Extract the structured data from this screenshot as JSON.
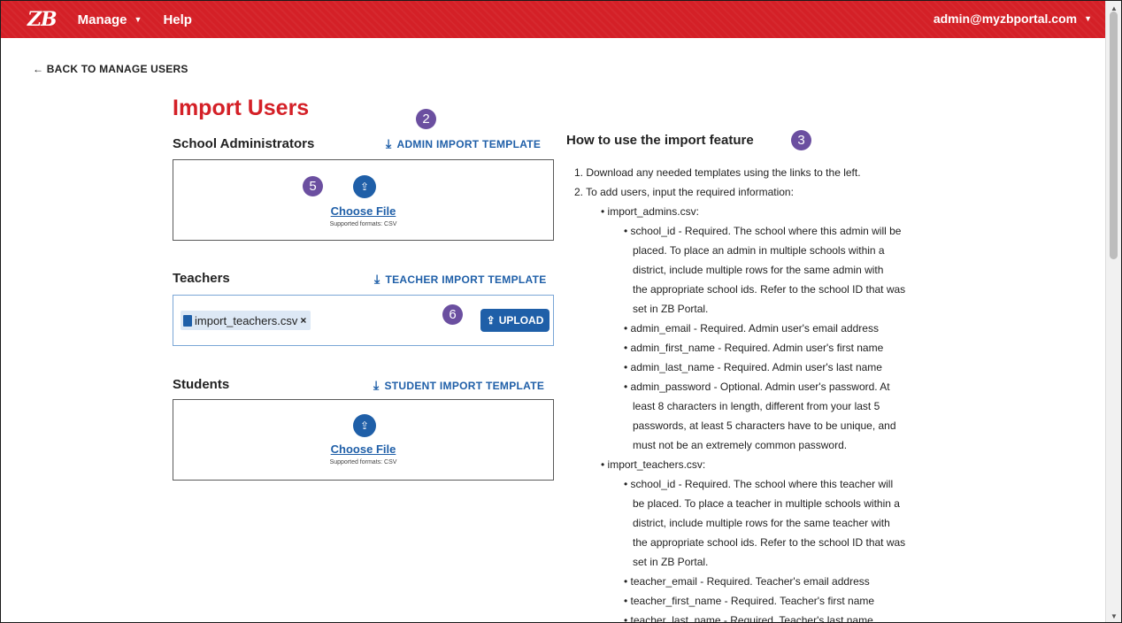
{
  "nav": {
    "logo": "ZB",
    "manage": "Manage",
    "help": "Help",
    "user": "admin@myzbportal.com"
  },
  "back_link": "← BACK TO MANAGE USERS",
  "page_title": "Import Users",
  "admins": {
    "label": "School Administrators",
    "template_link": "ADMIN IMPORT TEMPLATE",
    "choose": "Choose File",
    "formats": "Supported formats: CSV"
  },
  "teachers": {
    "label": "Teachers",
    "template_link": "TEACHER IMPORT TEMPLATE",
    "file": "import_teachers.csv",
    "remove": "×",
    "upload": "UPLOAD"
  },
  "students": {
    "label": "Students",
    "template_link": "STUDENT IMPORT TEMPLATE",
    "choose": "Choose File",
    "formats": "Supported formats: CSV"
  },
  "badges": {
    "b2": "2",
    "b3": "3",
    "b5": "5",
    "b6": "6"
  },
  "howto": {
    "title": "How to use the import feature",
    "lines": [
      "1. Download any needed templates using the links to the left.",
      "2. To add users, input the required information:",
      "• import_admins.csv:",
      "• school_id - Required. The school where this admin will be",
      "placed. To place an admin in multiple schools within a",
      "district, include multiple rows for the same admin with",
      "the appropriate school ids. Refer to the school ID that was",
      "set in ZB Portal.",
      "• admin_email - Required. Admin user's email address",
      "• admin_first_name - Required. Admin user's first name",
      "• admin_last_name - Required. Admin user's last name",
      "• admin_password - Optional. Admin user's password. At",
      "least 8 characters in length, different from your last 5",
      "passwords, at least 5 characters have to be unique, and",
      "must not be an extremely common password.",
      "• import_teachers.csv:",
      "• school_id - Required. The school where this teacher will",
      "be placed. To place a teacher in multiple schools within a",
      "district, include multiple rows for the same teacher with",
      "the appropriate school ids. Refer to the school ID that was",
      "set in ZB Portal.",
      "• teacher_email - Required. Teacher's email address",
      "• teacher_first_name - Required. Teacher's first name",
      "• teacher_last_name - Required. Teacher's last name"
    ]
  },
  "colors": {
    "brand_red": "#d42027",
    "link_blue": "#1f5fa8",
    "badge_purple": "#6b4fa0"
  }
}
